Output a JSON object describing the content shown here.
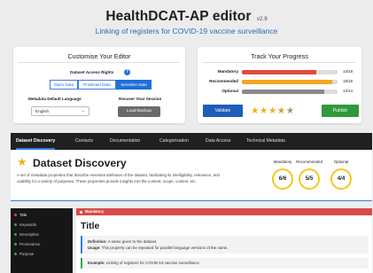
{
  "header": {
    "title": "HealthDCAT-AP editor",
    "version": "v2.9",
    "subtitle": "Linking of registers for COVID-19 vaccine surveillance"
  },
  "customise": {
    "title": "Customise Your Editor",
    "access_label": "Dataset Access Rights",
    "help_glyph": "?",
    "access_options": [
      "Open Data",
      "Protected Data",
      "Sensitive Data"
    ],
    "access_selected": "Sensitive Data",
    "language_label": "Metadata Default Language",
    "language_value": "English",
    "session_label": "Recover Your Session",
    "load_backup_label": "Load Backup"
  },
  "progress": {
    "title": "Track Your Progress",
    "rows": [
      {
        "label": "Mandatory",
        "count": "14/18",
        "fraction": 0.778,
        "color": "#e04a3c"
      },
      {
        "label": "Recommended",
        "count": "18/19",
        "fraction": 0.947,
        "color": "#f5a623"
      },
      {
        "label": "Optional",
        "count": "12/14",
        "fraction": 0.857,
        "color": "#8a8a8a"
      }
    ],
    "validate_label": "Validate",
    "publish_label": "Publish",
    "rating": 3.5,
    "stars": [
      "★",
      "★",
      "★",
      "★",
      "★"
    ]
  },
  "tabs": [
    "Dataset Discovery",
    "Contacts",
    "Documentation",
    "Categorisation",
    "Data Access",
    "Technical Metadata"
  ],
  "active_tab": "Dataset Discovery",
  "section": {
    "icon": "star-icon",
    "title": "Dataset Discovery",
    "description": "A set of metadata properties that describe essential attributes of the dataset, facilitating its intelligibility, relevance, and usability for a variety of purposes. These properties provide insights into the content, scope, context, etc.",
    "metrics": [
      {
        "label": "Mandatory",
        "value": "6/6"
      },
      {
        "label": "Recommended",
        "value": "5/5"
      },
      {
        "label": "Optional",
        "value": "4/4"
      }
    ]
  },
  "sidebar": {
    "items": [
      "Title",
      "Keywords",
      "Description",
      "Provenance",
      "Purpose"
    ],
    "active": "Title"
  },
  "field": {
    "badge": "Mandatory",
    "title": "Title",
    "definition_label": "Definition:",
    "definition": "A name given to the dataset.",
    "usage_label": "Usage:",
    "usage": "This property can be repeated for parallel language versions of the name.",
    "example_label": "Example:",
    "example": "Linking of registers for COVID-19 vaccine surveillance"
  },
  "colors": {
    "accent": "#1f6fd8",
    "mandatory": "#d94a4a",
    "publish": "#2e9a3a",
    "ring": "#f2c91e"
  }
}
